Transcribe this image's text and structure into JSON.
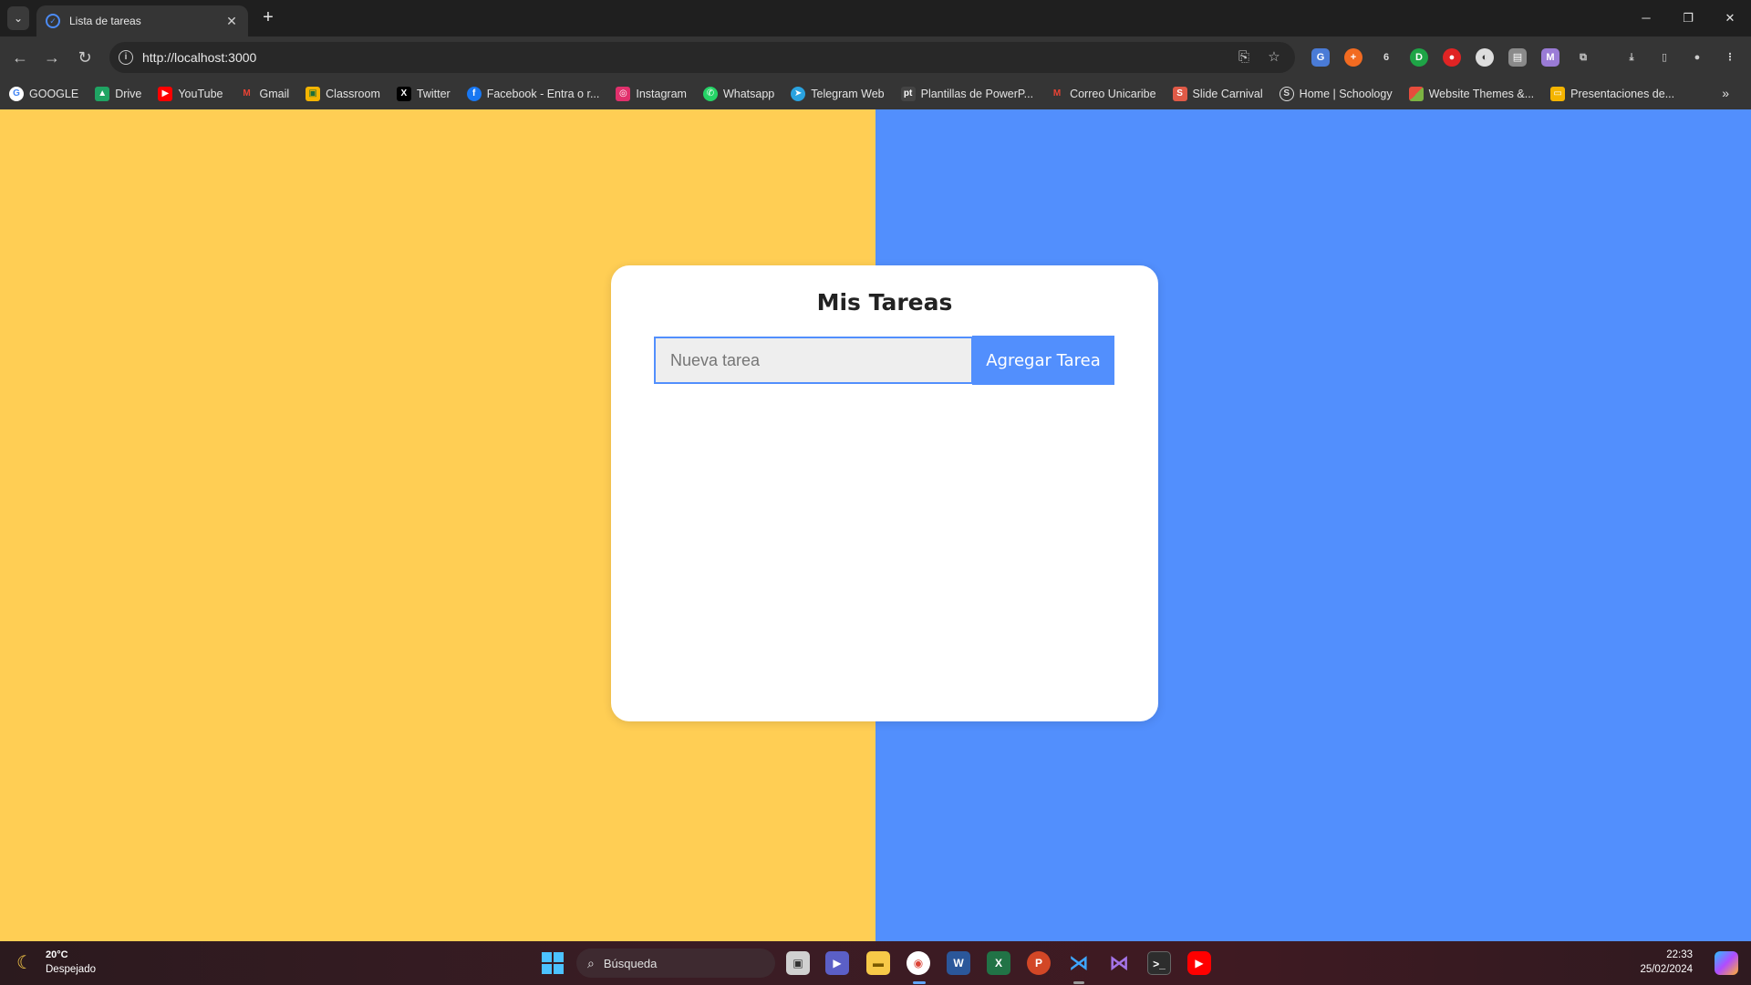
{
  "browser": {
    "tab_title": "Lista de tareas",
    "url": "http://localhost:3000",
    "bookmarks": [
      {
        "label": "GOOGLE",
        "icon": "google-icon",
        "color": "#ffffff"
      },
      {
        "label": "Drive",
        "icon": "drive-icon",
        "color": "#1fa463"
      },
      {
        "label": "YouTube",
        "icon": "youtube-icon",
        "color": "#ff0000"
      },
      {
        "label": "Gmail",
        "icon": "gmail-icon",
        "color": "#ea4335"
      },
      {
        "label": "Classroom",
        "icon": "classroom-icon",
        "color": "#f4b400"
      },
      {
        "label": "Twitter",
        "icon": "x-icon",
        "color": "#000000"
      },
      {
        "label": "Facebook - Entra o r...",
        "icon": "facebook-icon",
        "color": "#1877f2"
      },
      {
        "label": "Instagram",
        "icon": "instagram-icon",
        "color": "#e1306c"
      },
      {
        "label": "Whatsapp",
        "icon": "whatsapp-icon",
        "color": "#25d366"
      },
      {
        "label": "Telegram Web",
        "icon": "telegram-icon",
        "color": "#2aa3e0"
      },
      {
        "label": "Plantillas de PowerP...",
        "icon": "pt-icon",
        "color": "#444444"
      },
      {
        "label": "Correo Unicaribe",
        "icon": "gmail-icon",
        "color": "#ea4335"
      },
      {
        "label": "Slide Carnival",
        "icon": "slidecarnival-icon",
        "color": "#e05a47"
      },
      {
        "label": "Home | Schoology",
        "icon": "schoology-icon",
        "color": "#1f2a3a"
      },
      {
        "label": "Website Themes &...",
        "icon": "themes-icon",
        "color": "#7cb342"
      },
      {
        "label": "Presentaciones de...",
        "icon": "slides-icon",
        "color": "#f4b400"
      }
    ]
  },
  "app": {
    "title": "Mis Tareas",
    "input_placeholder": "Nueva tarea",
    "input_value": "",
    "add_button_label": "Agregar Tarea",
    "colors": {
      "left_panel": "#ffce54",
      "right_panel": "#528ffd",
      "accent": "#528ffd"
    }
  },
  "taskbar": {
    "weather_temp": "20°C",
    "weather_desc": "Despejado",
    "search_placeholder": "Búsqueda",
    "time": "22:33",
    "date": "25/02/2024"
  }
}
